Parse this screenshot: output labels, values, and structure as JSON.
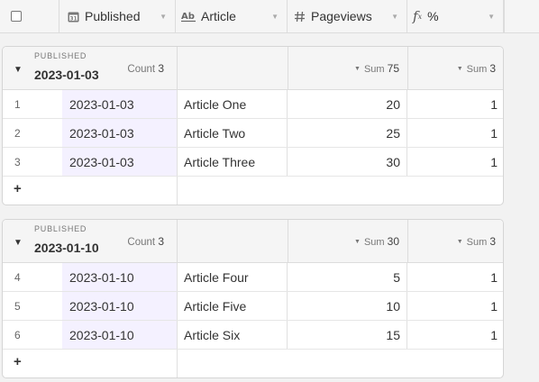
{
  "columns": {
    "published": "Published",
    "article": "Article",
    "pageviews": "Pageviews",
    "percent": "%"
  },
  "icons": {
    "date": "calendar-icon",
    "text": "text-field-icon",
    "number": "hash-icon",
    "formula": "formula-icon"
  },
  "groups": [
    {
      "field_label": "PUBLISHED",
      "value": "2023-01-03",
      "count_label": "Count",
      "count": "3",
      "sum_label": "Sum",
      "pageviews_sum": "75",
      "percent_sum": "3",
      "rows": [
        {
          "num": "1",
          "date": "2023-01-03",
          "article": "Article One",
          "pageviews": "20",
          "percent": "1"
        },
        {
          "num": "2",
          "date": "2023-01-03",
          "article": "Article Two",
          "pageviews": "25",
          "percent": "1"
        },
        {
          "num": "3",
          "date": "2023-01-03",
          "article": "Article Three",
          "pageviews": "30",
          "percent": "1"
        }
      ],
      "add": "+"
    },
    {
      "field_label": "PUBLISHED",
      "value": "2023-01-10",
      "count_label": "Count",
      "count": "3",
      "sum_label": "Sum",
      "pageviews_sum": "30",
      "percent_sum": "3",
      "rows": [
        {
          "num": "4",
          "date": "2023-01-10",
          "article": "Article Four",
          "pageviews": "5",
          "percent": "1"
        },
        {
          "num": "5",
          "date": "2023-01-10",
          "article": "Article Five",
          "pageviews": "10",
          "percent": "1"
        },
        {
          "num": "6",
          "date": "2023-01-10",
          "article": "Article Six",
          "pageviews": "15",
          "percent": "1"
        }
      ],
      "add": "+"
    }
  ],
  "colors": {
    "date_cell_bg": "#f4f1ff",
    "header_bg": "#f5f5f5",
    "page_bg": "#f2f2f2"
  }
}
